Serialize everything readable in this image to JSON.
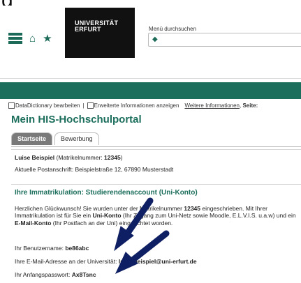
{
  "header": {
    "logo_text": "UNIVERSITÄT\nERFURT",
    "search_label": "Menü durchsuchen",
    "search_value": ""
  },
  "options": {
    "datadictionary": "DataDictionary bearbeiten",
    "separator": "|",
    "erweiterte": "Erweiterte Informationen anzeigen",
    "weitere": "Weitere Informationen",
    "seite": "Seite:"
  },
  "page": {
    "title": "Mein HIS-Hochschulportal"
  },
  "tabs": [
    {
      "label": "Startseite",
      "active": true
    },
    {
      "label": "Bewerbung",
      "active": false
    }
  ],
  "student": {
    "name": "Luise Beispiel",
    "matrikel_prefix": "(Matrikelnummer:",
    "matrikel": "12345",
    "matrikel_suffix": ")",
    "address_label": "Aktuelle Postanschrift:",
    "address": "Beispielstraße 12, 67890 Musterstadt"
  },
  "enrollment": {
    "heading": "Ihre Immatrikulation: Studierendenaccount (Uni-Konto)",
    "p1": "Herzlichen Glückwunsch! Sie wurden unter der Matrikelnummer ",
    "p1_num": "12345",
    "p2": " eingeschrieben. Mit Ihrer Immatrikulation ist für Sie ein ",
    "p2_b": "Uni-Konto",
    "p3": " (Ihr Zugang zum Uni-Netz sowie Moodle, E.L.V.I.S. u.a.w) und ein ",
    "p3_b": "E-Mail-Konto",
    "p4": " (Ihr Postfach an der Uni) eingerichtet worden.",
    "username_label": "Ihr Benutzername:",
    "username": "be86abc",
    "email_label": "Ihre E-Mail-Adresse an der Universität:",
    "email": "luise.beispiel@uni-erfurt.de",
    "password_label": "Ihr Anfangspasswort:",
    "password": "Ax8Tsnc"
  },
  "colors": {
    "brand_green": "#1c6e5c",
    "arrow": "#0f1f63"
  },
  "icons": [
    "menu-icon",
    "home-icon",
    "star-icon",
    "search-icon",
    "arrow-annotation"
  ]
}
